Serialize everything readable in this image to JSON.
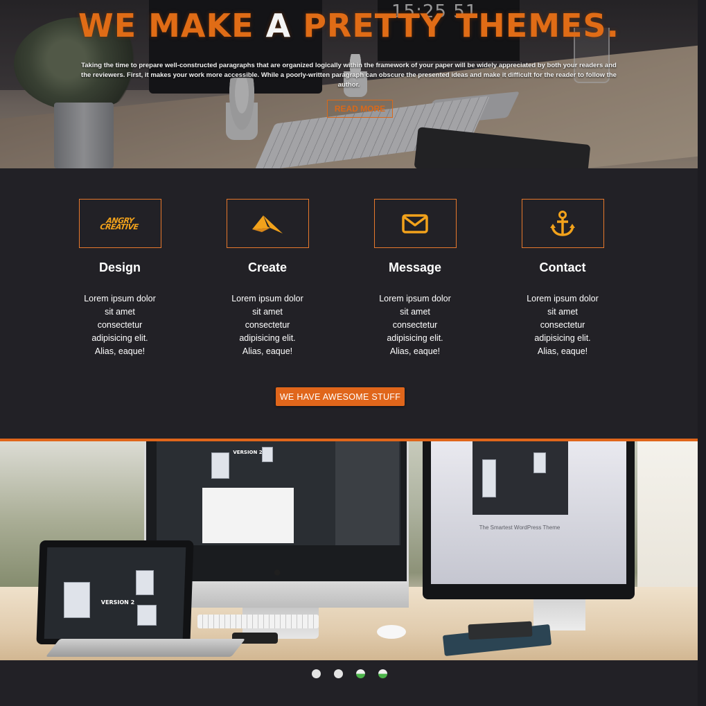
{
  "hero": {
    "title_part1": "WE MAKE ",
    "title_highlight": "A",
    "title_part2": " PRETTY THEMES",
    "title_end": ".",
    "clock": "15:25 51",
    "paragraph": "Taking the time to prepare well-constructed paragraphs that are organized logically within the framework of your paper will be widely appreciated by both your readers and the reviewers. First, it makes your work more accessible. While a poorly-written paragraph can obscure the presented ideas and make it difficult for the reader to follow the author.",
    "button_label": "READ MORE"
  },
  "features": [
    {
      "icon": "angry-creative-logo",
      "brand_line1": "ANGRY",
      "brand_line2": "CREATIVE",
      "title": "Design",
      "desc": "Lorem ipsum dolor sit amet consectetur adipisicing elit. Alias, eaque!"
    },
    {
      "icon": "paper-plane-icon",
      "title": "Create",
      "desc": "Lorem ipsum dolor sit amet consectetur adipisicing elit. Alias, eaque!"
    },
    {
      "icon": "envelope-icon",
      "title": "Message",
      "desc": "Lorem ipsum dolor sit amet consectetur adipisicing elit. Alias, eaque!"
    },
    {
      "icon": "anchor-icon",
      "title": "Contact",
      "desc": "Lorem ipsum dolor sit amet consectetur adipisicing elit. Alias, eaque!"
    }
  ],
  "cta": {
    "label": "WE HAVE AWESOME STUFF"
  },
  "slider": {
    "version_label": "VERSION 2",
    "monitor_caption": "The Smartest WordPress Theme",
    "dots": [
      "slide-1",
      "slide-2",
      "slide-3",
      "slide-4"
    ],
    "active_dot_color": "#4cb54a"
  },
  "colors": {
    "accent": "#e0661b",
    "icon_orange": "#f2a21b",
    "background": "#222126"
  }
}
